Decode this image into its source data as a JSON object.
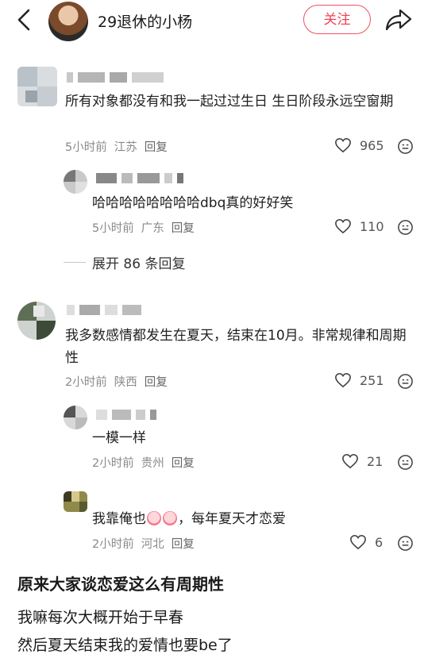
{
  "header": {
    "title": "29退休的小杨",
    "follow_label": "关注"
  },
  "comments": [
    {
      "text": "所有对象都没有和我一起过过生日 生日阶段永远空窗期",
      "time": "5小时前",
      "location": "江苏",
      "reply_label": "回复",
      "likes": "965",
      "replies": [
        {
          "text": "哈哈哈哈哈哈哈哈dbq真的好好笑",
          "time": "5小时前",
          "location": "广东",
          "reply_label": "回复",
          "likes": "110"
        }
      ],
      "expand_label": "展开 86 条回复"
    },
    {
      "text": "我多数感情都发生在夏天，结束在10月。非常规律和周期性",
      "time": "2小时前",
      "location": "陕西",
      "reply_label": "回复",
      "likes": "251",
      "replies": [
        {
          "text": "一模一样",
          "time": "2小时前",
          "location": "贵州",
          "reply_label": "回复",
          "likes": "21"
        },
        {
          "text_before": "我靠俺也",
          "text_after": "，每年夏天才恋爱",
          "time": "2小时前",
          "location": "河北",
          "reply_label": "回复",
          "likes": "6"
        }
      ]
    }
  ],
  "post": {
    "title": "原来大家谈恋爱这么有周期性",
    "line1": "我嘛每次大概开始于早春",
    "line2": "然后夏天结束我的爱情也要be了"
  },
  "icons": {
    "back": "back-arrow-icon",
    "share": "share-icon",
    "like": "heart-icon",
    "comment": "comment-emoji-icon"
  },
  "colors": {
    "follow_accent": "#f04355",
    "meta_gray": "#8a8a8a"
  }
}
